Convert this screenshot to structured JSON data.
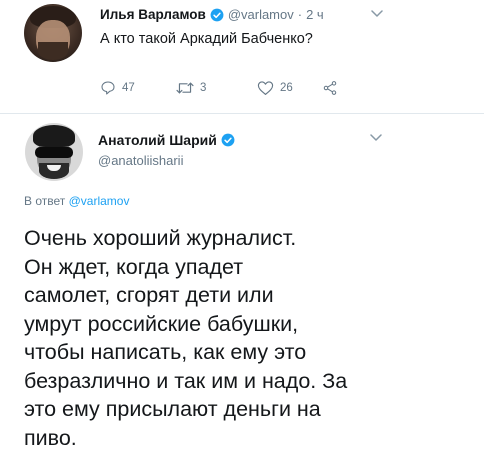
{
  "colors": {
    "text": "#14171a",
    "secondary": "#657786",
    "link": "#1da1f2",
    "verified": "#1da1f2",
    "divider": "#e1e8ed"
  },
  "tweet1": {
    "author_name": "Илья Варламов",
    "handle": "@varlamov",
    "separator": "·",
    "time": "2 ч",
    "text": "А кто такой Аркадий Бабченко?",
    "actions": {
      "reply_icon": "reply-icon",
      "reply_count": "47",
      "retweet_icon": "retweet-icon",
      "retweet_count": "3",
      "like_icon": "heart-icon",
      "like_count": "26",
      "share_icon": "share-icon"
    },
    "menu_icon": "chevron-down-icon"
  },
  "tweet2": {
    "author_name": "Анатолий Шарий",
    "handle": "@anatoliisharii",
    "reply_prefix": "В ответ",
    "reply_mention": "@varlamov",
    "menu_icon": "chevron-down-icon",
    "body_lines": [
      "Очень хороший журналист.",
      "Он ждет, когда упадет",
      "самолет, сгорят дети или",
      "умрут российские бабушки,",
      "чтобы написать, как ему это",
      "безразлично и так им и надо. За",
      "это ему присылают деньги на",
      "пиво."
    ]
  }
}
